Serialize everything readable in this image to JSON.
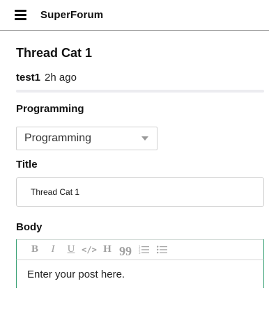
{
  "header": {
    "brand": "SuperForum",
    "menu_icon": "hamburger-menu-icon"
  },
  "thread": {
    "title": "Thread Cat 1",
    "author": "test1",
    "time": "2h ago"
  },
  "category": {
    "label": "Programming",
    "selected": "Programming",
    "caret_icon": "caret-down-icon"
  },
  "title_field": {
    "label": "Title",
    "value": "Thread Cat 1"
  },
  "body_field": {
    "label": "Body",
    "placeholder": "Enter your post here.",
    "toolbar": {
      "bold": "B",
      "italic": "I",
      "underline": "U",
      "code": "</>",
      "heading": "H",
      "quote": "99"
    }
  },
  "colors": {
    "editor_accent": "#3aa275",
    "toolbar_icon": "#a0a0a0",
    "divider": "#ececf0"
  }
}
